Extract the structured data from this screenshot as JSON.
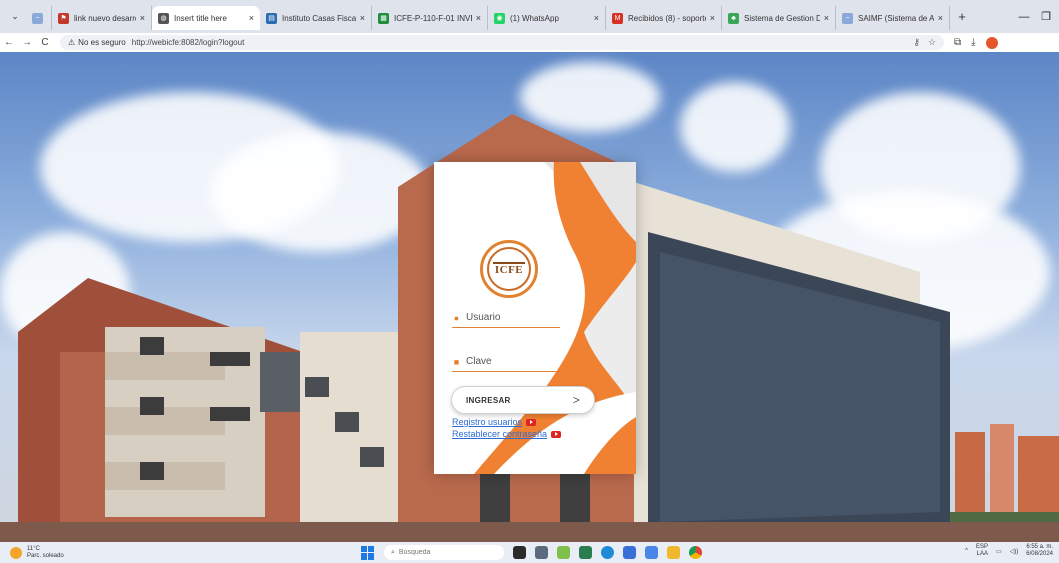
{
  "browser": {
    "tabs": [
      {
        "title": "",
        "favicon": "saimf-logo",
        "color": "#8aa8d8",
        "active": false
      },
      {
        "title": "link nuevo desarrollo - c",
        "favicon": "flag",
        "color": "#c0392b",
        "active": false
      },
      {
        "title": "Insert title here",
        "favicon": "globe",
        "color": "#555555",
        "active": true
      },
      {
        "title": "Instituto Casas Fiscales",
        "favicon": "page",
        "color": "#2b6cb0",
        "active": false
      },
      {
        "title": "ICFE-P-110-F-01 INVENT",
        "favicon": "sheets",
        "color": "#1e8e3e",
        "active": false
      },
      {
        "title": "(1) WhatsApp",
        "favicon": "whatsapp",
        "color": "#25d366",
        "active": false
      },
      {
        "title": "Recibidos (8) - soporte",
        "favicon": "gmail",
        "color": "#d93025",
        "active": false
      },
      {
        "title": "Sistema de Gestion Doc",
        "favicon": "leaf",
        "color": "#3aa757",
        "active": false
      },
      {
        "title": "SAIMF (Sistema de Adm",
        "favicon": "saimf-logo",
        "color": "#8aa8d8",
        "active": false
      }
    ],
    "new_tab": "+",
    "nav": {
      "back": "←",
      "forward": "→",
      "reload": "C"
    },
    "address": {
      "security": "No es seguro",
      "url": "http://webicfe:8082/login?logout"
    }
  },
  "login": {
    "logo_text": "ICFE",
    "username_placeholder": "Usuario",
    "password_placeholder": "Clave",
    "submit_label": "INGRESAR",
    "register_link": "Registro usuarios",
    "reset_link": "Restablecer contraseña",
    "accent": "#f08132"
  },
  "taskbar": {
    "weather_temp": "11°C",
    "weather_desc": "Parc. soleado",
    "search_placeholder": "Búsqueda",
    "lang_top": "ESP",
    "lang_bottom": "LAA",
    "time": "6:55 a. m.",
    "date": "6/08/2024"
  }
}
